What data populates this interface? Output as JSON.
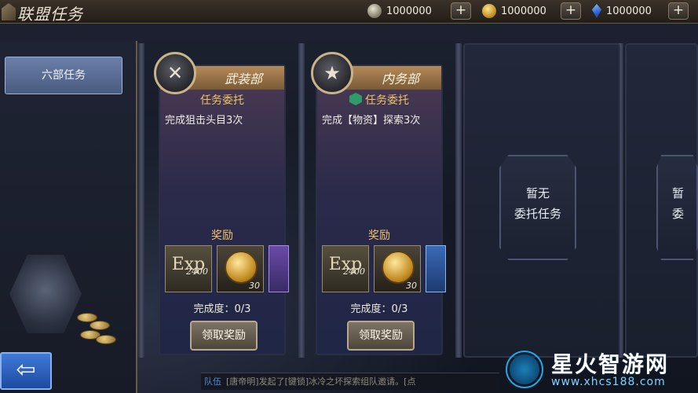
{
  "header": {
    "title": "联盟任务",
    "resources": [
      {
        "icon": "silver-coin-icon",
        "value": "1000000"
      },
      {
        "icon": "gold-coin-icon",
        "value": "1000000"
      },
      {
        "icon": "blue-gem-icon",
        "value": "1000000"
      }
    ],
    "plus_label": "+"
  },
  "sidebar": {
    "tab_label": "六部任务"
  },
  "cards": [
    {
      "department": "武装部",
      "badge_icon": "crossed-rifles-icon",
      "entrust_label": "任务委托",
      "task": "完成狙击头目3次",
      "reward_label": "奖励",
      "rewards": [
        {
          "icon": "exp-icon",
          "label": "Exp",
          "qty": "2400"
        },
        {
          "icon": "gold-coin-icon",
          "qty": "30"
        },
        {
          "icon": "purple-item-icon"
        }
      ],
      "progress": "完成度：0/3",
      "claim_label": "领取奖励"
    },
    {
      "department": "内务部",
      "badge_icon": "star-wreath-icon",
      "entrust_label": "任务委托",
      "task": "完成【物资】探索3次",
      "reward_label": "奖励",
      "rewards": [
        {
          "icon": "exp-icon",
          "label": "Exp",
          "qty": "2400"
        },
        {
          "icon": "gold-coin-icon",
          "qty": "30"
        },
        {
          "icon": "blue-item-icon"
        }
      ],
      "progress": "完成度：0/3",
      "claim_label": "领取奖励"
    }
  ],
  "empty_slots": [
    {
      "line1": "暂无",
      "line2": "委托任务"
    },
    {
      "line1": "暂",
      "line2": "委"
    }
  ],
  "nav": {
    "back_icon": "back-arrow-icon",
    "back_glyph": "⇦"
  },
  "chat": {
    "tag": "队伍",
    "message": "[唐帝明]发起了[键锁]冰冷之坏探索组队邀请。[点"
  },
  "watermark": {
    "title": "星火智游网",
    "url": "www.xhcs188.com"
  },
  "colors": {
    "accent_gold": "#f2c26a",
    "tab_blue": "#5b6e96",
    "back_blue": "#2f63c4"
  }
}
